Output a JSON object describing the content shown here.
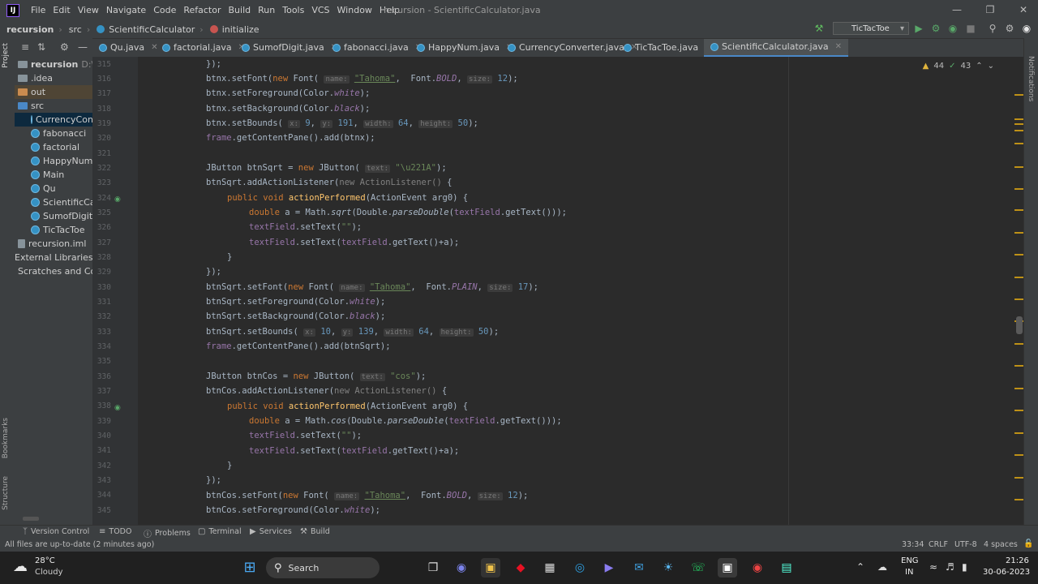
{
  "menubar": {
    "items": [
      "File",
      "Edit",
      "View",
      "Navigate",
      "Code",
      "Refactor",
      "Build",
      "Run",
      "Tools",
      "VCS",
      "Window",
      "Help"
    ],
    "window_title": "recursion - ScientificCalculator.java"
  },
  "navbar": {
    "crumbs": [
      "recursion",
      "src",
      "ScientificCalculator",
      "initialize"
    ],
    "run_config": "TicTacToe"
  },
  "project": {
    "tab_label": "Project",
    "root": "recursion",
    "root_path": "D:\\java co",
    "items": [
      ".idea",
      "out",
      "src",
      "CurrencyConv",
      "fabonacci",
      "factorial",
      "HappyNum",
      "Main",
      "Qu",
      "ScientificCalc",
      "SumofDigit",
      "TicTacToe",
      "recursion.iml",
      "External Libraries",
      "Scratches and Conso"
    ]
  },
  "left_tabs": [
    "Bookmarks",
    "Structure"
  ],
  "right_tabs": [
    "Notifications"
  ],
  "tabs": [
    "Qu.java",
    "factorial.java",
    "SumofDigit.java",
    "fabonacci.java",
    "HappyNum.java",
    "CurrencyConverter.java",
    "TicTacToe.java",
    "ScientificCalculator.java"
  ],
  "inspections": {
    "warnings": "44",
    "ok": "43"
  },
  "editor": {
    "line_numbers": [
      "315",
      "316",
      "317",
      "318",
      "319",
      "320",
      "321",
      "322",
      "323",
      "324",
      "325",
      "326",
      "327",
      "328",
      "329",
      "330",
      "331",
      "332",
      "333",
      "334",
      "335",
      "336",
      "337",
      "338",
      "339",
      "340",
      "341",
      "342",
      "343",
      "344",
      "345"
    ],
    "hints": {
      "name": "name:",
      "size": "size:",
      "x": "x:",
      "y": "y:",
      "width": "width:",
      "height": "height:",
      "text": "text:"
    },
    "tokens": {
      "close_brace_paren": "});",
      "btnx": "btnx",
      "setFont": ".setFont(",
      "new": "new",
      "Font": " Font(",
      "tahoma": "\"Tahoma\"",
      "font_bold": " Font.",
      "BOLD": "BOLD",
      "PLAIN": "PLAIN",
      "v12": "12",
      "v17": "17",
      "end_paren": ");",
      "setForeground": ".setForeground(Color.",
      "white": "white",
      "setBackground": ".setBackground(Color.",
      "black": "black",
      "setBounds": ".setBounds(",
      "v9": "9",
      "v191": "191",
      "v64": "64",
      "v50": "50",
      "v10": "10",
      "v139": "139",
      "frame": "frame",
      "getContentPane_btnx": ".getContentPane().add(btnx);",
      "getContentPane_sqrt": ".getContentPane().add(btnSqrt);",
      "jbutton_sqrt": "JButton btnSqrt = ",
      "jbutton_ctor": " JButton(",
      "str_sqrt": "\"\\u221A\"",
      "btnSqrt": "btnSqrt",
      "addActionListener": ".addActionListener(",
      "new_al": "new ActionListener() ",
      "open_brace": "{",
      "public_void": "public void",
      "actionPerformed": "actionPerformed",
      "ae_args": "(ActionEvent arg0) {",
      "double": "double",
      "a_eq_math": " a = Math.",
      "sqrt": "sqrt",
      "cos": "cos",
      "double_paren": "(Double.",
      "parseDouble": "parseDouble",
      "tf_get_open": "(",
      "textField": "textField",
      "get_text_close": ".getText()));",
      "set_text_empty": ".setText(",
      "empty_str": "\"\"",
      "set_text_sum_open": ".setText(",
      "get_text_plus_a": ".getText()+a);",
      "close_brace": "}",
      "jbutton_cos": "JButton btnCos = ",
      "str_cos": "\"cos\"",
      "btnCos": "btnCos"
    }
  },
  "toolwindows": [
    "Version Control",
    "TODO",
    "Problems",
    "Terminal",
    "Services",
    "Build"
  ],
  "status": {
    "message": "All files are up-to-date (2 minutes ago)",
    "position": "33:34",
    "line_sep": "CRLF",
    "encoding": "UTF-8",
    "indent": "4 spaces"
  },
  "taskbar": {
    "weather_temp": "28°C",
    "weather_desc": "Cloudy",
    "search_label": "Search",
    "lang": "ENG",
    "region": "IN",
    "time": "21:26",
    "date": "30-06-2023"
  }
}
